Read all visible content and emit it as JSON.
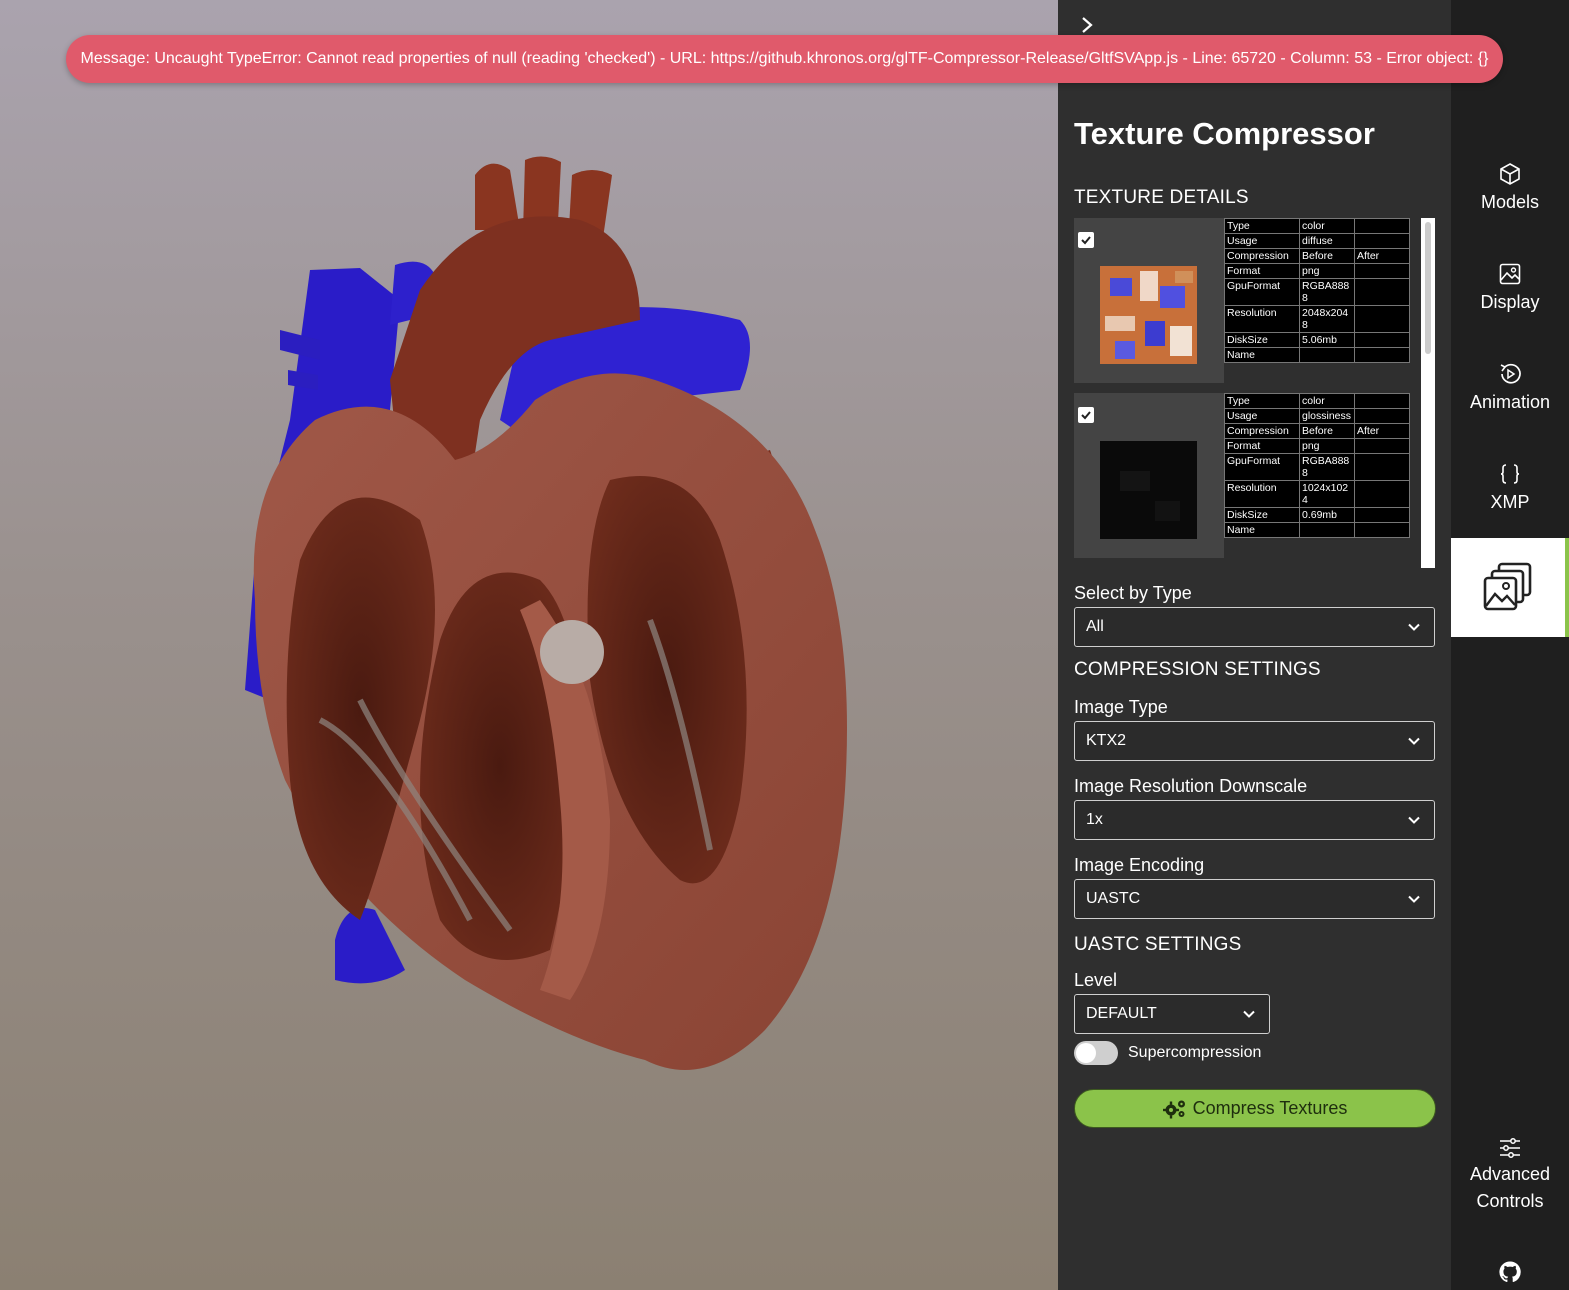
{
  "error": {
    "message": "Message: Uncaught TypeError: Cannot read properties of null (reading 'checked') - URL: https://github.khronos.org/glTF-Compressor-Release/GltfSVApp.js - Line: 65720 - Column: 53 - Error object: {}"
  },
  "panel": {
    "title": "Texture Compressor",
    "texture_details_heading": "TEXTURE DETAILS",
    "textures": [
      {
        "checked": true,
        "rows": [
          [
            "Type",
            "color",
            ""
          ],
          [
            "Usage",
            "diffuse",
            ""
          ],
          [
            "Compression",
            "Before",
            "After"
          ],
          [
            "Format",
            "png",
            ""
          ],
          [
            "GpuFormat",
            "RGBA8888",
            ""
          ],
          [
            "Resolution",
            "2048x2048",
            ""
          ],
          [
            "DiskSize",
            "5.06mb",
            ""
          ],
          [
            "Name",
            "",
            ""
          ]
        ]
      },
      {
        "checked": true,
        "rows": [
          [
            "Type",
            "color",
            ""
          ],
          [
            "Usage",
            "glossiness",
            ""
          ],
          [
            "Compression",
            "Before",
            "After"
          ],
          [
            "Format",
            "png",
            ""
          ],
          [
            "GpuFormat",
            "RGBA8888",
            ""
          ],
          [
            "Resolution",
            "1024x1024",
            ""
          ],
          [
            "DiskSize",
            "0.69mb",
            ""
          ],
          [
            "Name",
            "",
            ""
          ]
        ]
      }
    ],
    "select_by_type": {
      "label": "Select by Type",
      "value": "All"
    },
    "compression_heading": "COMPRESSION SETTINGS",
    "image_type": {
      "label": "Image Type",
      "value": "KTX2"
    },
    "downscale": {
      "label": "Image Resolution Downscale",
      "value": "1x"
    },
    "encoding": {
      "label": "Image Encoding",
      "value": "UASTC"
    },
    "uastc_heading": "UASTC SETTINGS",
    "level": {
      "label": "Level",
      "value": "DEFAULT"
    },
    "supercompression": {
      "label": "Supercompression",
      "enabled": false
    },
    "compress_button": "Compress Textures"
  },
  "nav": {
    "items": [
      {
        "label": "Models",
        "icon": "cube-icon"
      },
      {
        "label": "Display",
        "icon": "image-icon"
      },
      {
        "label": "Animation",
        "icon": "play-rotate-icon"
      },
      {
        "label": "XMP",
        "icon": "braces-icon"
      },
      {
        "label": "",
        "icon": "texture-stack-icon",
        "active": true
      },
      {
        "label": "Advanced Controls",
        "icon": "sliders-icon"
      },
      {
        "label": "",
        "icon": "github-icon"
      }
    ]
  },
  "colors": {
    "accent": "#8bc34a",
    "error": "#e05a6b",
    "panel": "#2f2f2f",
    "nav": "#1f1f1f"
  }
}
